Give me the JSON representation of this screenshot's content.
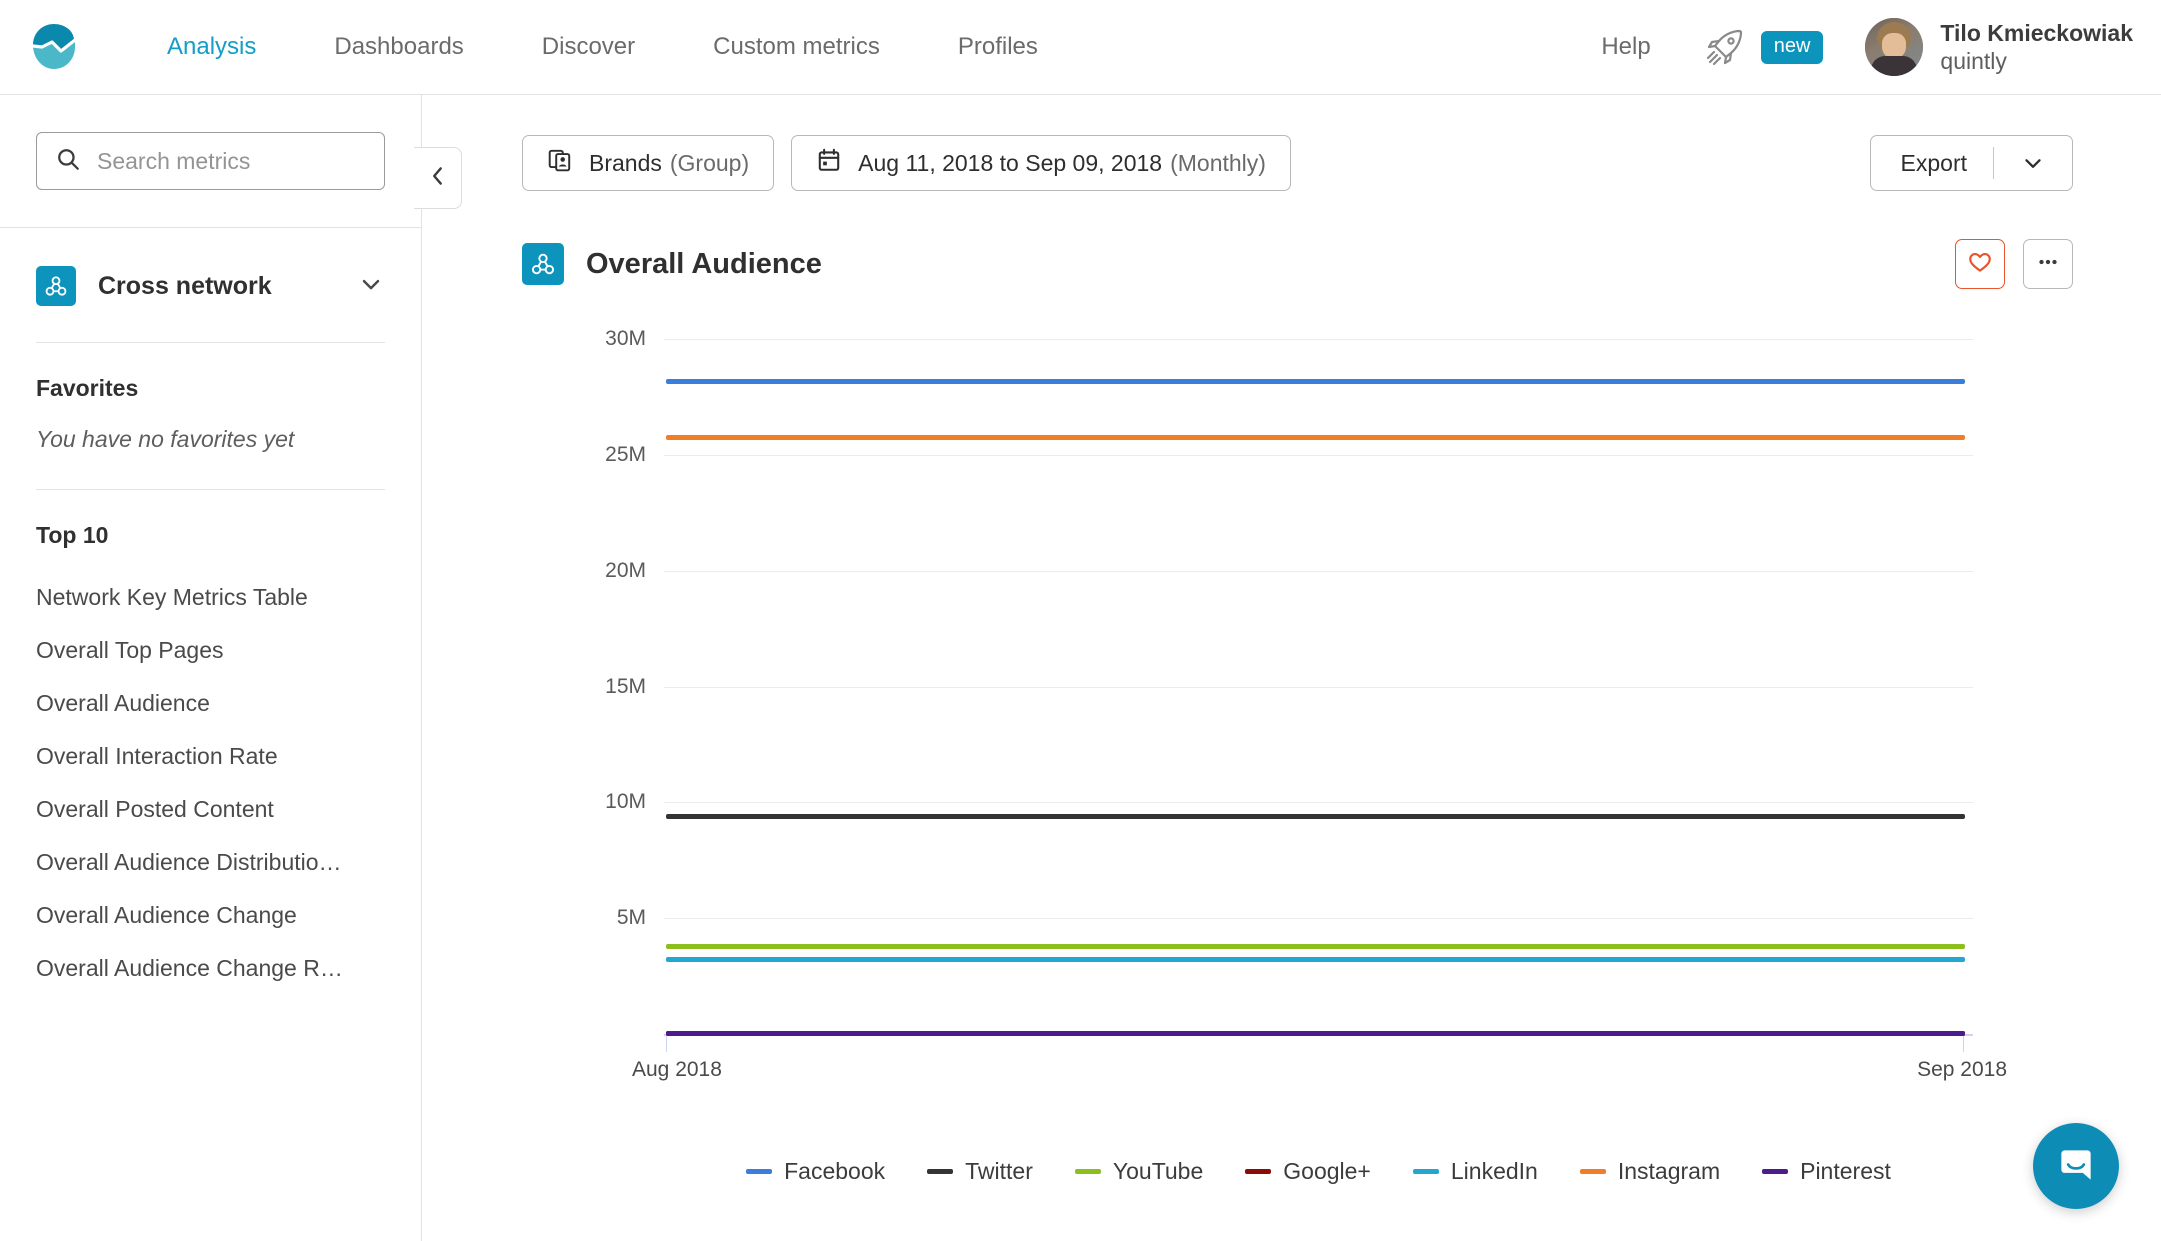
{
  "header": {
    "logo_icon": "quintly-logo-icon",
    "nav": [
      {
        "label": "Analysis",
        "active": true
      },
      {
        "label": "Dashboards",
        "active": false
      },
      {
        "label": "Discover",
        "active": false
      },
      {
        "label": "Custom metrics",
        "active": false
      },
      {
        "label": "Profiles",
        "active": false
      }
    ],
    "help_label": "Help",
    "rocket_icon": "rocket-icon",
    "new_badge": "new",
    "user": {
      "name": "Tilo Kmieckowiak",
      "org": "quintly"
    }
  },
  "sidebar": {
    "search": {
      "placeholder": "Search metrics",
      "value": "",
      "icon": "search-icon"
    },
    "network": {
      "label": "Cross network",
      "icon": "cross-network-icon",
      "chevron": "chevron-down-icon"
    },
    "favorites": {
      "title": "Favorites",
      "empty_text": "You have no favorites yet"
    },
    "top10": {
      "title": "Top 10",
      "items": [
        {
          "label": "Network Key Metrics Table"
        },
        {
          "label": "Overall Top Pages"
        },
        {
          "label": "Overall Audience"
        },
        {
          "label": "Overall Interaction Rate"
        },
        {
          "label": "Overall Posted Content"
        },
        {
          "label": "Overall Audience Distribution Develop…"
        },
        {
          "label": "Overall Audience Change"
        },
        {
          "label": "Overall Audience Change Rate"
        }
      ]
    },
    "collapse_icon": "chevron-left-icon"
  },
  "toolbar": {
    "brands_chip": {
      "label": "Brands",
      "suffix": "(Group)",
      "icon": "profiles-group-icon"
    },
    "date_chip": {
      "label": "Aug 11, 2018 to Sep 09, 2018",
      "suffix": "(Monthly)",
      "icon": "calendar-icon"
    },
    "export": {
      "label": "Export",
      "caret_icon": "chevron-down-icon"
    }
  },
  "card": {
    "icon": "cross-network-icon",
    "title": "Overall Audience",
    "favorite_icon": "heart-icon",
    "favorite_color": "#e8542c",
    "more_icon": "ellipsis-icon"
  },
  "intercom": {
    "icon": "chat-bubble-icon",
    "color": "#0d8cb5"
  },
  "chart_data": {
    "type": "line",
    "title": "Overall Audience",
    "xlabel": "",
    "ylabel": "",
    "x": [
      "Aug 2018",
      "Sep 2018"
    ],
    "xticks": [
      "Aug 2018",
      "Sep 2018"
    ],
    "yticks": [
      "5M",
      "10M",
      "15M",
      "20M",
      "25M",
      "30M"
    ],
    "ylim": [
      0,
      30000000
    ],
    "grid": true,
    "legend_position": "bottom",
    "series": [
      {
        "name": "Facebook",
        "color": "#3b7ddb",
        "values": [
          28200000,
          28200000
        ]
      },
      {
        "name": "Twitter",
        "color": "#343434",
        "values": [
          9400000,
          9400000
        ]
      },
      {
        "name": "YouTube",
        "color": "#8cbe1e",
        "values": [
          3800000,
          3800000
        ]
      },
      {
        "name": "Google+",
        "color": "#8a0b08",
        "values": [
          60000,
          60000
        ]
      },
      {
        "name": "LinkedIn",
        "color": "#21a7d0",
        "values": [
          3250000,
          3250000
        ]
      },
      {
        "name": "Instagram",
        "color": "#f07d28",
        "values": [
          25750000,
          25750000
        ]
      },
      {
        "name": "Pinterest",
        "color": "#4b1d8c",
        "values": [
          30000,
          30000
        ]
      }
    ]
  }
}
